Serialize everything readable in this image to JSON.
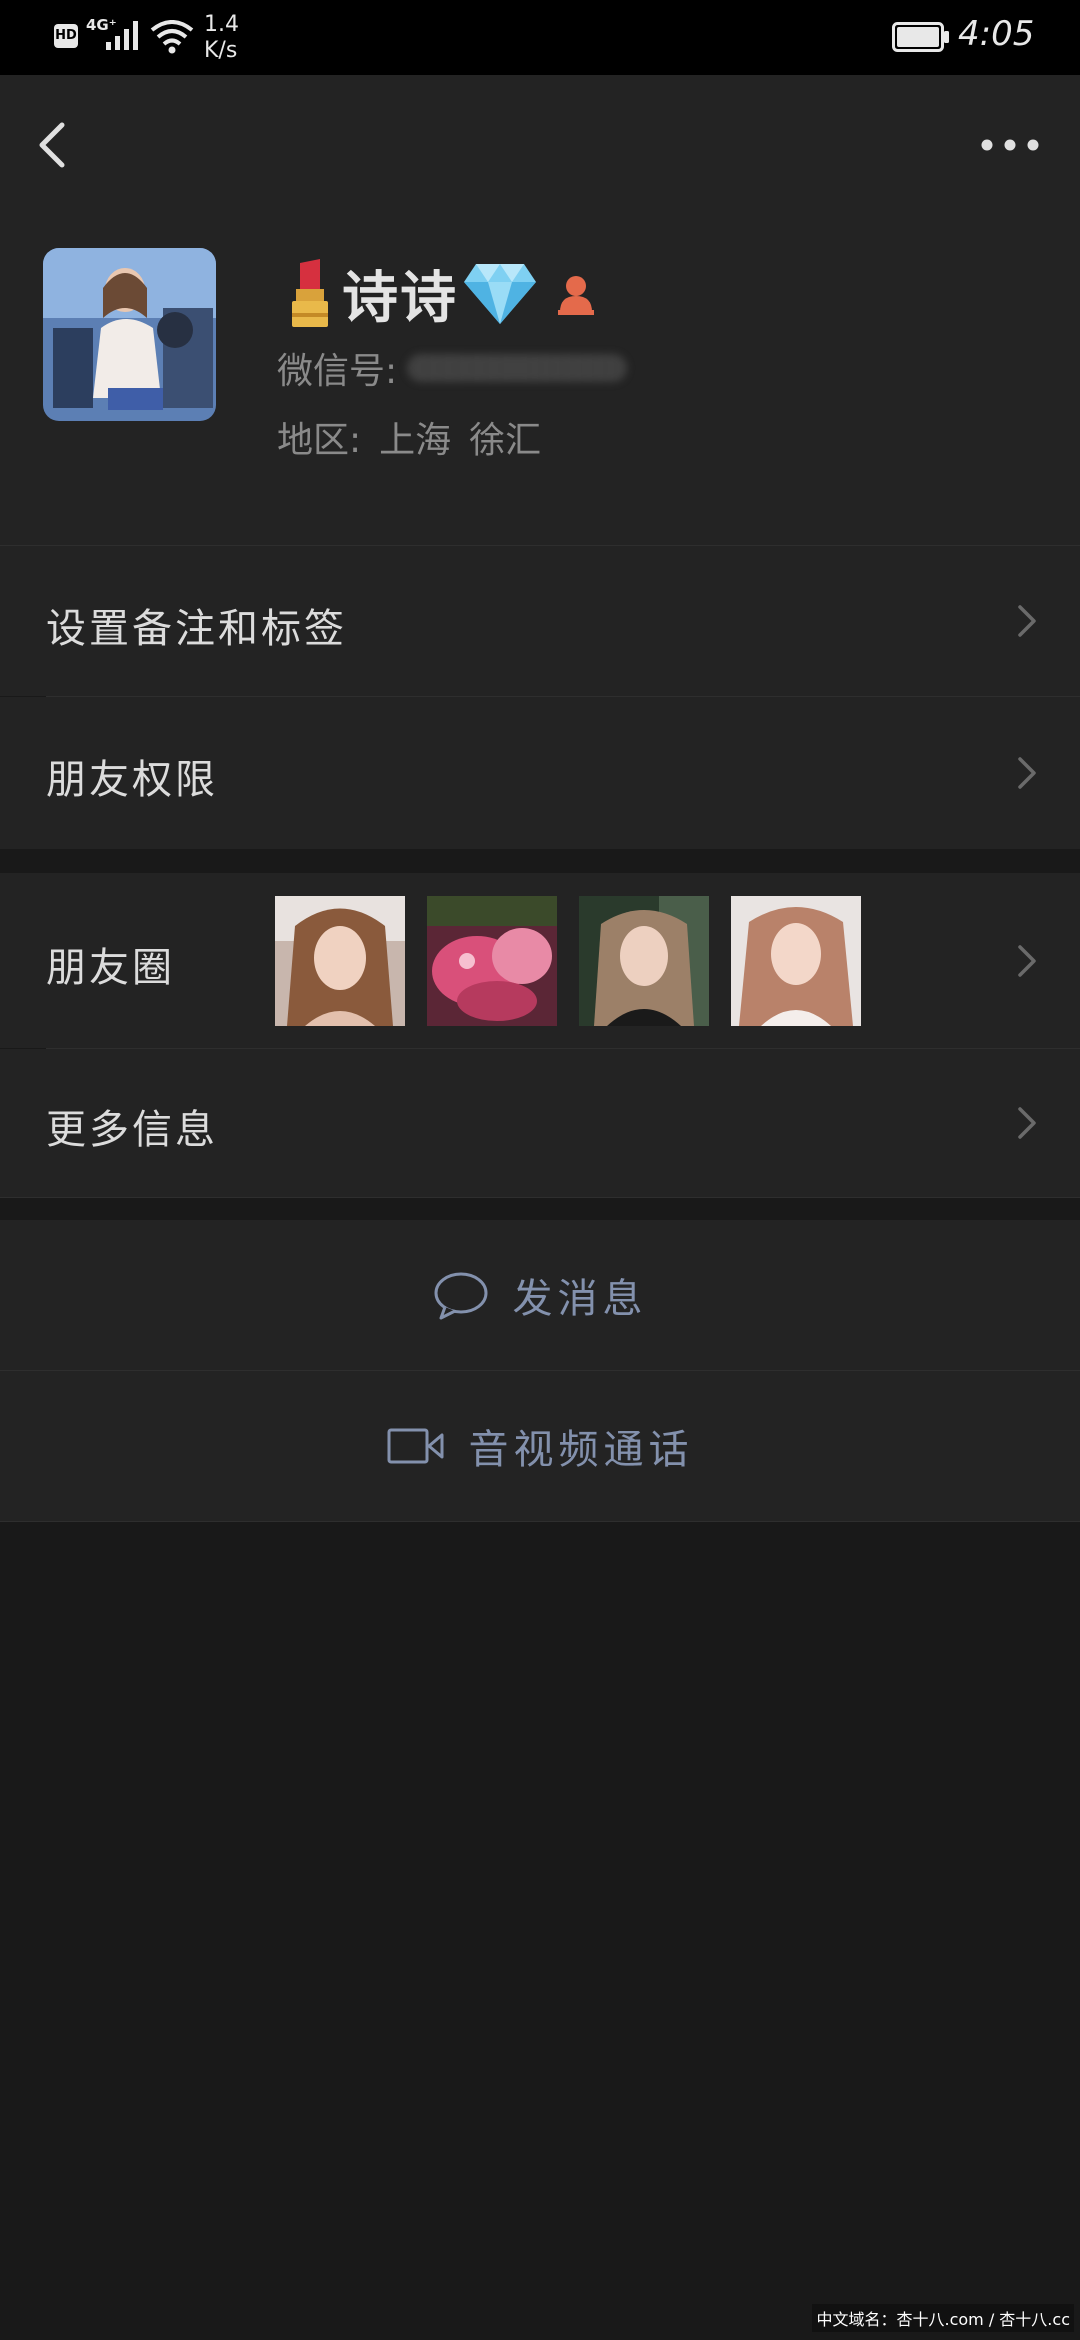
{
  "status_bar": {
    "hd_label": "HD",
    "network_label": "4G⁺",
    "speed_value": "1.4",
    "speed_unit": "K/s",
    "time": "4:05"
  },
  "profile": {
    "nickname": "诗诗",
    "wechat_id_label": "微信号:",
    "region_label": "地区:",
    "region_province": "上海",
    "region_district": "徐汇"
  },
  "menu": {
    "set_remark": "设置备注和标签",
    "friend_permission": "朋友权限",
    "moments": "朋友圈",
    "more_info": "更多信息"
  },
  "actions": {
    "send_message": "发消息",
    "video_call": "音视频通话"
  },
  "watermark": "中文域名：杏十八.com / 杏十八.cc",
  "colors": {
    "background": "#191919",
    "cell": "#232323",
    "accent_link": "#8391ad",
    "status_bar": "#000000"
  }
}
